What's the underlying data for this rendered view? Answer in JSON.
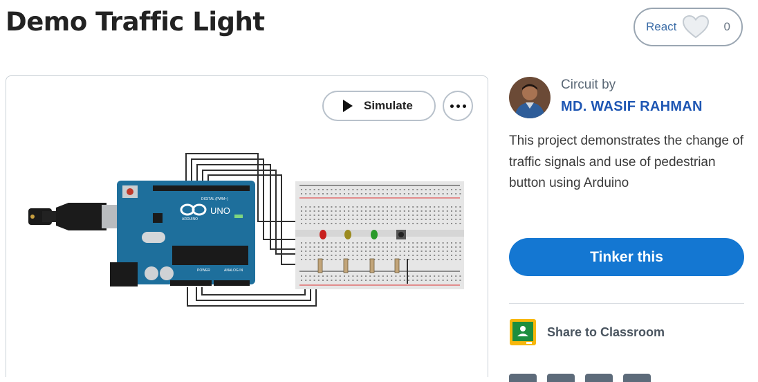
{
  "page": {
    "title": "Demo Traffic Light"
  },
  "react": {
    "label": "React",
    "count": "0",
    "icon": "heart-outline-icon"
  },
  "toolbar": {
    "simulate_label": "Simulate",
    "more_icon": "more-options-icon",
    "play_icon": "play-icon"
  },
  "circuit": {
    "board_logo": "UNO",
    "board_brand": "ARDUINO",
    "digital_label": "DIGITAL (PWM~)",
    "power_label": "POWER",
    "analog_label": "ANALOG IN",
    "led_colors": [
      "#c8201e",
      "#9b8a1f",
      "#2a9a2a"
    ]
  },
  "author": {
    "circuit_by": "Circuit by",
    "name": "MD. WASIF RAHMAN"
  },
  "description": "This project demonstrates the change of traffic signals and use of pedestrian button using Arduino",
  "actions": {
    "tinker_label": "Tinker this",
    "share_classroom_label": "Share to Classroom"
  },
  "colors": {
    "accent": "#1477d2",
    "author": "#1e56b3",
    "classroom_green": "#1e8e3e",
    "classroom_yellow": "#f7b70c"
  }
}
